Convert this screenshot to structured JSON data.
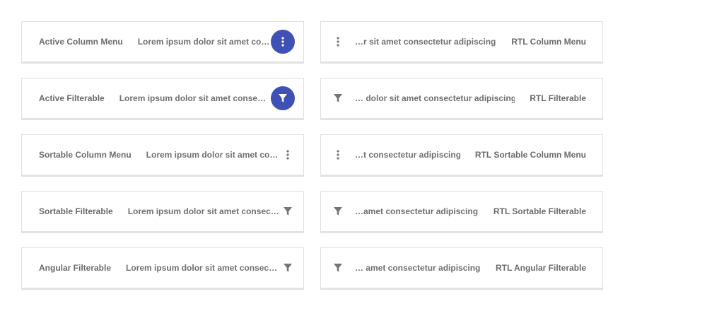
{
  "headers": [
    {
      "title": "Active Column Menu",
      "text": "Lorem ipsum dolor sit amet conse…",
      "icon": "more-vert-icon"
    },
    {
      "title": "Active Filterable",
      "text": "Lorem ipsum dolor sit amet consectet…",
      "icon": "filter-icon"
    },
    {
      "title": "Sortable Column Menu",
      "text": "Lorem ipsum dolor sit amet con…",
      "icon": "more-vert-icon"
    },
    {
      "title": "Sortable Filterable",
      "text": "Lorem ipsum dolor sit amet consect…",
      "icon": "filter-icon"
    },
    {
      "title": "Angular Filterable",
      "text": "Lorem ipsum dolor sit amet consecte…",
      "icon": "filter-icon"
    }
  ],
  "rtl_headers": [
    {
      "title": "RTL Column Menu",
      "text": "…r sit amet consectetur adipiscing elit",
      "icon": "more-vert-icon"
    },
    {
      "title": "RTL Filterable",
      "text": "… dolor sit amet consectetur adipiscing elit",
      "icon": "filter-icon"
    },
    {
      "title": "RTL Sortable Column Menu",
      "text": "…t consectetur adipiscing elit",
      "icon": "more-vert-icon"
    },
    {
      "title": "RTL Sortable Filterable",
      "text": "…amet consectetur adipiscing elit",
      "icon": "filter-icon"
    },
    {
      "title": "RTL Angular Filterable",
      "text": "… amet consectetur adipiscing elit",
      "icon": "filter-icon"
    }
  ],
  "colors": {
    "active_button": "#3f51b5",
    "icon_grey": "#757575",
    "text_grey": "#6b6b6b",
    "border": "#e0e0e0"
  }
}
